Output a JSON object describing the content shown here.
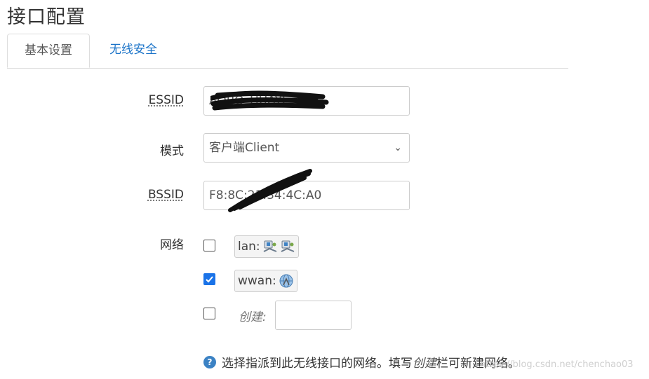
{
  "page": {
    "title": "接口配置"
  },
  "tabs": [
    {
      "label": "基本设置",
      "active": true
    },
    {
      "label": "无线安全",
      "active": false
    }
  ],
  "form": {
    "essid": {
      "label": "ESSID",
      "value": "AOBO_HUAYE"
    },
    "mode": {
      "label": "模式",
      "value": "客户端Client",
      "options": [
        "客户端Client"
      ]
    },
    "bssid": {
      "label": "BSSID",
      "value": "F8:8C:21:34:4C:A0"
    },
    "network": {
      "label": "网络",
      "items": [
        {
          "label": "lan:",
          "checked": false,
          "icons": [
            "lan-port-icon",
            "lan-port-icon"
          ]
        },
        {
          "label": "wwan:",
          "checked": true,
          "icons": [
            "wifi-globe-icon"
          ]
        }
      ],
      "create": {
        "label": "创建:",
        "checked": false,
        "value": ""
      }
    }
  },
  "help": {
    "prefix": "选择指派到此无线接口的网络。填写",
    "emphasis": "创建",
    "suffix": "栏可新建网络。"
  },
  "watermark": "https://blog.csdn.net/chenchao03",
  "colors": {
    "link": "#1a73c8",
    "checkbox_checked": "#1a73e8",
    "help_icon": "#3b82c4"
  }
}
